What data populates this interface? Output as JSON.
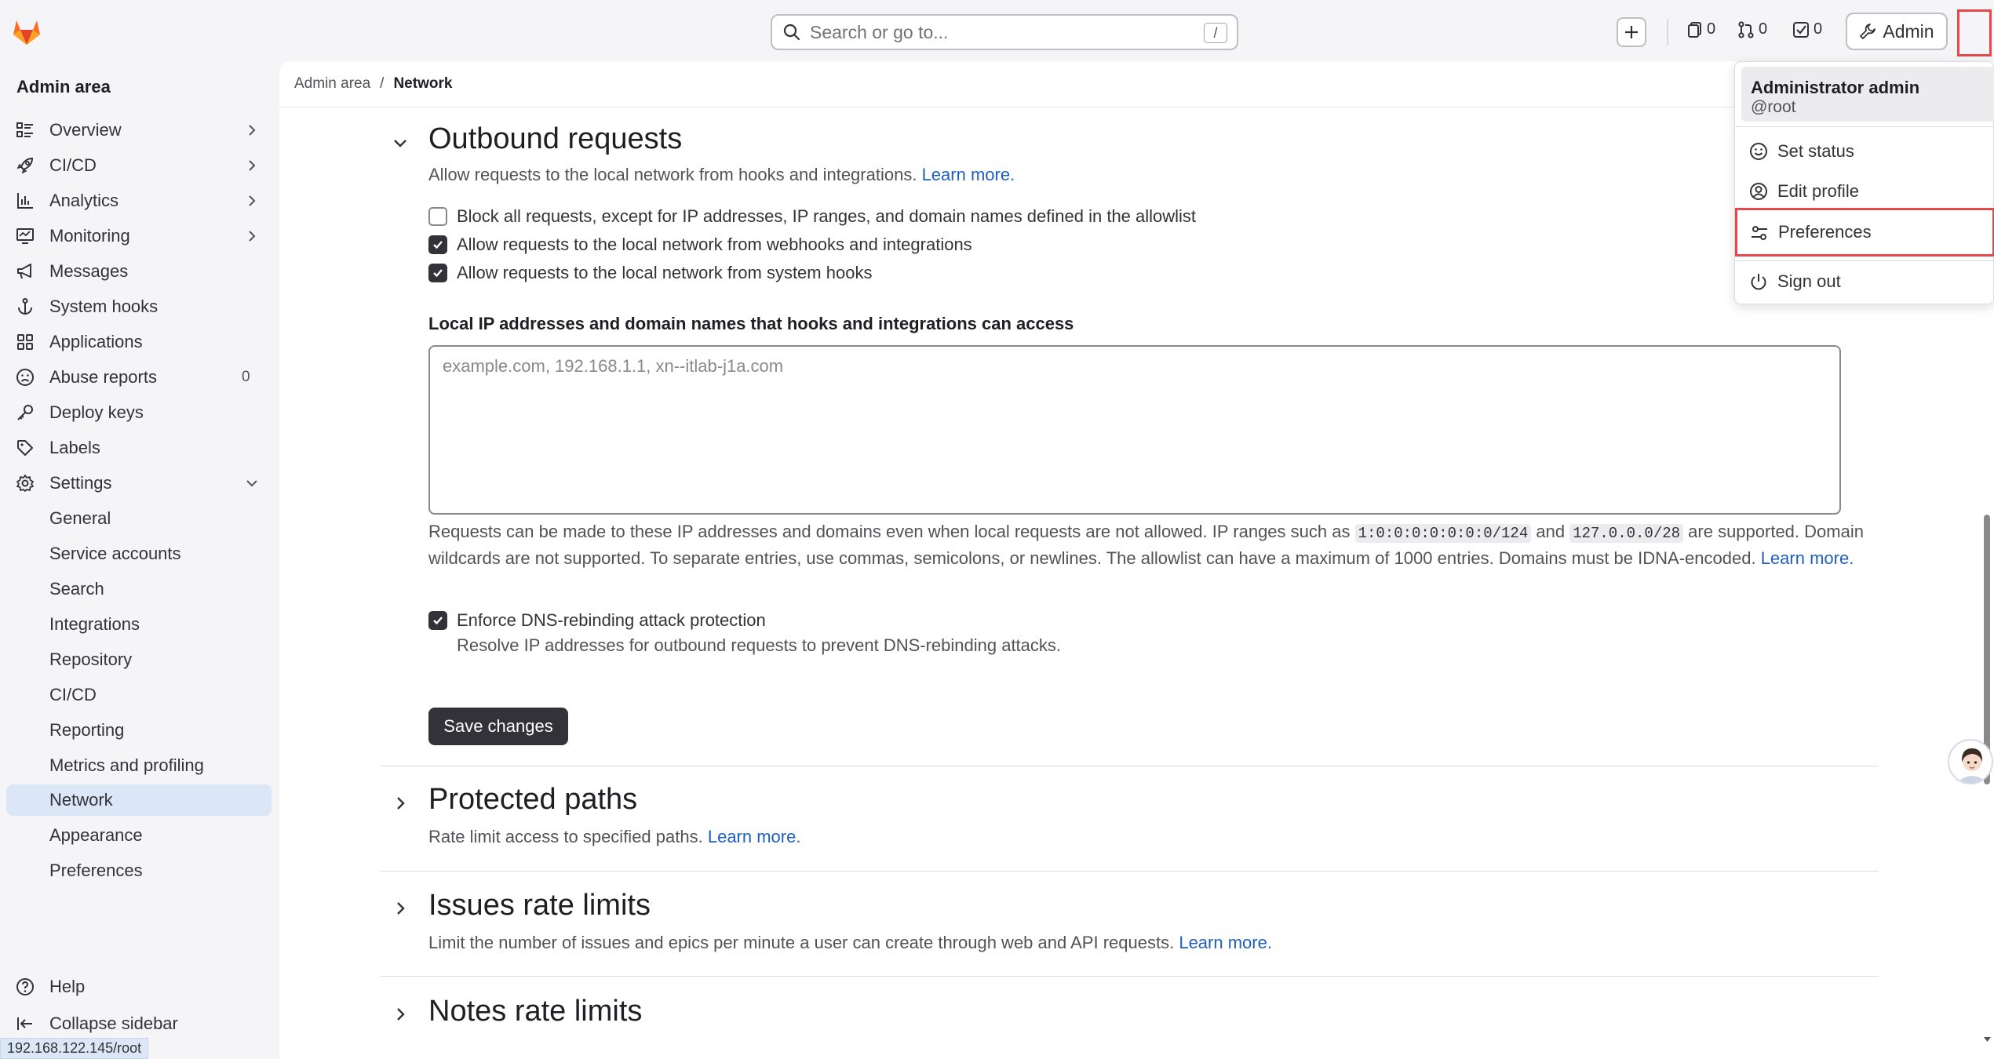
{
  "search": {
    "placeholder": "Search or go to...",
    "shortcut": "/"
  },
  "topbar": {
    "counters": [
      {
        "name": "issues",
        "value": "0"
      },
      {
        "name": "merge-requests",
        "value": "0"
      },
      {
        "name": "todos",
        "value": "0"
      }
    ],
    "admin_label": "Admin"
  },
  "sidebar": {
    "title": "Admin area",
    "items": [
      {
        "label": "Overview",
        "icon": "overview-icon",
        "chevron": "right"
      },
      {
        "label": "CI/CD",
        "icon": "rocket-icon",
        "chevron": "right"
      },
      {
        "label": "Analytics",
        "icon": "chart-icon",
        "chevron": "right"
      },
      {
        "label": "Monitoring",
        "icon": "monitor-icon",
        "chevron": "right"
      },
      {
        "label": "Messages",
        "icon": "megaphone-icon"
      },
      {
        "label": "System hooks",
        "icon": "anchor-icon"
      },
      {
        "label": "Applications",
        "icon": "grid-icon"
      },
      {
        "label": "Abuse reports",
        "icon": "frown-icon",
        "count": "0"
      },
      {
        "label": "Deploy keys",
        "icon": "key-icon"
      },
      {
        "label": "Labels",
        "icon": "label-icon"
      },
      {
        "label": "Settings",
        "icon": "gear-icon",
        "chevron": "down"
      }
    ],
    "settings_sub": [
      "General",
      "Service accounts",
      "Search",
      "Integrations",
      "Repository",
      "CI/CD",
      "Reporting",
      "Metrics and profiling",
      "Network",
      "Appearance",
      "Preferences"
    ],
    "active_sub": "Network",
    "help_label": "Help",
    "collapse_label": "Collapse sidebar"
  },
  "status_url": "192.168.122.145/root",
  "breadcrumb": {
    "root": "Admin area",
    "sep": "/",
    "current": "Network"
  },
  "outbound": {
    "title": "Outbound requests",
    "desc": "Allow requests to the local network from hooks and integrations.",
    "learn_more": "Learn more.",
    "checkboxes": [
      {
        "label": "Block all requests, except for IP addresses, IP ranges, and domain names defined in the allowlist",
        "checked": false
      },
      {
        "label": "Allow requests to the local network from webhooks and integrations",
        "checked": true
      },
      {
        "label": "Allow requests to the local network from system hooks",
        "checked": true
      }
    ],
    "allowlist_label": "Local IP addresses and domain names that hooks and integrations can access",
    "allowlist_placeholder": "example.com, 192.168.1.1, xn--itlab-j1a.com",
    "help_1": "Requests can be made to these IP addresses and domains even when local requests are not allowed. IP ranges such as",
    "help_code_1": "1:0:0:0:0:0:0:0/124",
    "help_and": "and",
    "help_code_2": "127.0.0.0/28",
    "help_2": "are supported. Domain wildcards are not supported. To separate entries, use commas, semicolons, or newlines. The allowlist can have a maximum of 1000 entries. Domains must be IDNA-encoded.",
    "help_learn_more": "Learn more.",
    "dns_label": "Enforce DNS-rebinding attack protection",
    "dns_checked": true,
    "dns_desc": "Resolve IP addresses for outbound requests to prevent DNS-rebinding attacks.",
    "save_label": "Save changes"
  },
  "sections": [
    {
      "title": "Protected paths",
      "desc": "Rate limit access to specified paths.",
      "learn_more": "Learn more."
    },
    {
      "title": "Issues rate limits",
      "desc": "Limit the number of issues and epics per minute a user can create through web and API requests.",
      "learn_more": "Learn more."
    },
    {
      "title": "Notes rate limits"
    }
  ],
  "user_menu": {
    "name": "Administrator admin",
    "handle": "@root",
    "items": [
      {
        "label": "Set status",
        "icon": "smiley-icon"
      },
      {
        "label": "Edit profile",
        "icon": "user-circle-icon"
      },
      {
        "label": "Preferences",
        "icon": "preferences-icon"
      },
      {
        "label": "Sign out",
        "icon": "power-icon"
      }
    ]
  },
  "colors": {
    "accent": "#1f5fc2",
    "active_bg": "#dbe6f6",
    "highlight": "#e5484d",
    "button_dark": "#333238"
  }
}
